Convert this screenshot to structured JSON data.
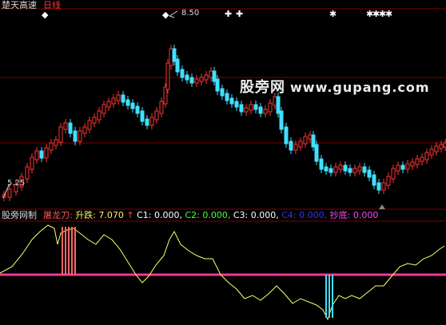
{
  "chart_title": {
    "stock_name": "楚天高速",
    "period": "日线"
  },
  "main_chart": {
    "high_label": "8.50",
    "low_label": "5.25",
    "star_glyph": "◆",
    "markers": [
      "✚",
      "✚",
      "✱",
      "✱",
      "✱",
      "✱",
      "✱"
    ],
    "up_color": "#ff3333",
    "down_color": "#40e0ff",
    "grid_color": "#800000"
  },
  "indicator": {
    "title": "股旁网制",
    "items": [
      {
        "label": "屠龙刀:",
        "value": "",
        "color": "#ff5555"
      },
      {
        "label": "升跌:",
        "value": "7.070",
        "color": "#ffee66"
      },
      {
        "label": "↑",
        "value": "",
        "color": "#ff4444"
      },
      {
        "label": "C1:",
        "value": "0.000,",
        "color": "#ffffff"
      },
      {
        "label": "C2:",
        "value": "0.000,",
        "color": "#44ff44"
      },
      {
        "label": "C3:",
        "value": "0.000,",
        "color": "#ffffff"
      },
      {
        "label": "C4:",
        "value": "0.000,",
        "color": "#3333ff"
      },
      {
        "label": "抄底:",
        "value": "0.000",
        "color": "#ff44ff"
      }
    ],
    "line_color": "#ffff66",
    "threshold_color": "#ff3399"
  },
  "watermark": {
    "text": "股旁网",
    "site": "www.gupang.com"
  }
}
